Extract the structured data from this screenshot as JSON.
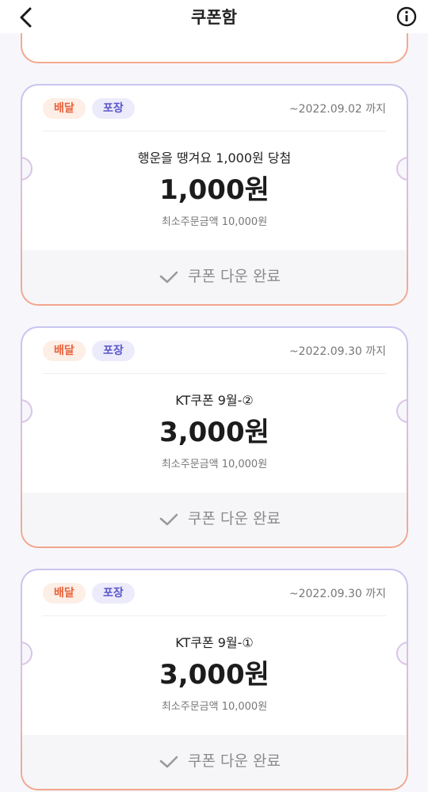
{
  "header": {
    "title": "쿠폰함",
    "back_icon": "chevron-left-icon",
    "info_icon": "info-circle-icon"
  },
  "colors": {
    "delivery_tag_bg": "#fdeee6",
    "delivery_tag_text": "#e8613a",
    "pickup_tag_bg": "#ecebfb",
    "pickup_tag_text": "#5b57c9",
    "card_border_top": "#c8c6f0",
    "card_border_bottom": "#f2a58b"
  },
  "coupons": [
    {
      "tags": [
        "배달",
        "포장"
      ],
      "expiry": "~2022.09.02 까지",
      "name": "행운을 땡겨요 1,000원 당첨",
      "amount": "1,000원",
      "min_order": "최소주문금액 10,000원",
      "status": "쿠폰 다운 완료"
    },
    {
      "tags": [
        "배달",
        "포장"
      ],
      "expiry": "~2022.09.30 까지",
      "name": "KT쿠폰 9월-②",
      "amount": "3,000원",
      "min_order": "최소주문금액 10,000원",
      "status": "쿠폰 다운 완료"
    },
    {
      "tags": [
        "배달",
        "포장"
      ],
      "expiry": "~2022.09.30 까지",
      "name": "KT쿠폰 9월-①",
      "amount": "3,000원",
      "min_order": "최소주문금액 10,000원",
      "status": "쿠폰 다운 완료"
    }
  ]
}
